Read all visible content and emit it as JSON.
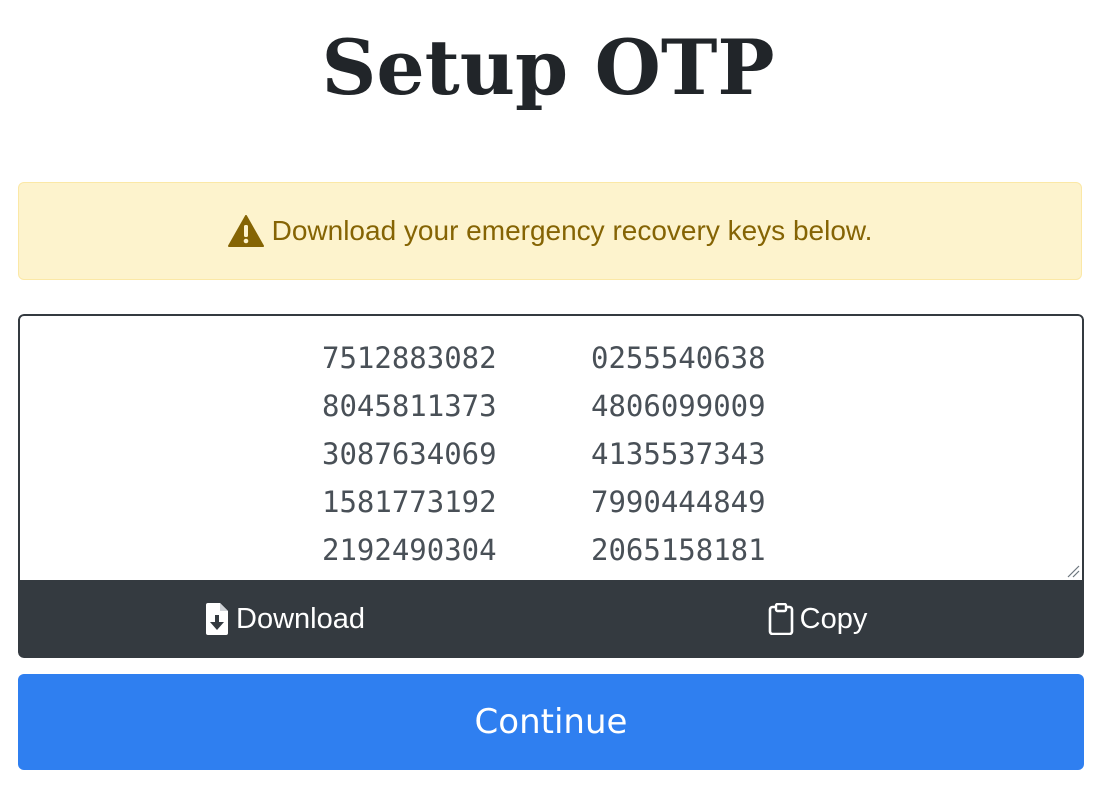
{
  "page": {
    "title": "Setup OTP"
  },
  "alert": {
    "icon": "warning-triangle-icon",
    "message": "Download your emergency recovery keys below.",
    "color": "#856404",
    "background": "#fdf3cd"
  },
  "recovery_keys": {
    "rows": [
      [
        "7512883082",
        "0255540638"
      ],
      [
        "8045811373",
        "4806099009"
      ],
      [
        "3087634069",
        "4135537343"
      ],
      [
        "1581773192",
        "7990444849"
      ],
      [
        "2192490304",
        "2065158181"
      ]
    ]
  },
  "actions": {
    "download": {
      "label": "Download",
      "icon": "file-download-icon"
    },
    "copy": {
      "label": "Copy",
      "icon": "clipboard-icon"
    },
    "bar_color": "#343a40"
  },
  "continue_button": {
    "label": "Continue",
    "color": "#2f7ff0"
  }
}
